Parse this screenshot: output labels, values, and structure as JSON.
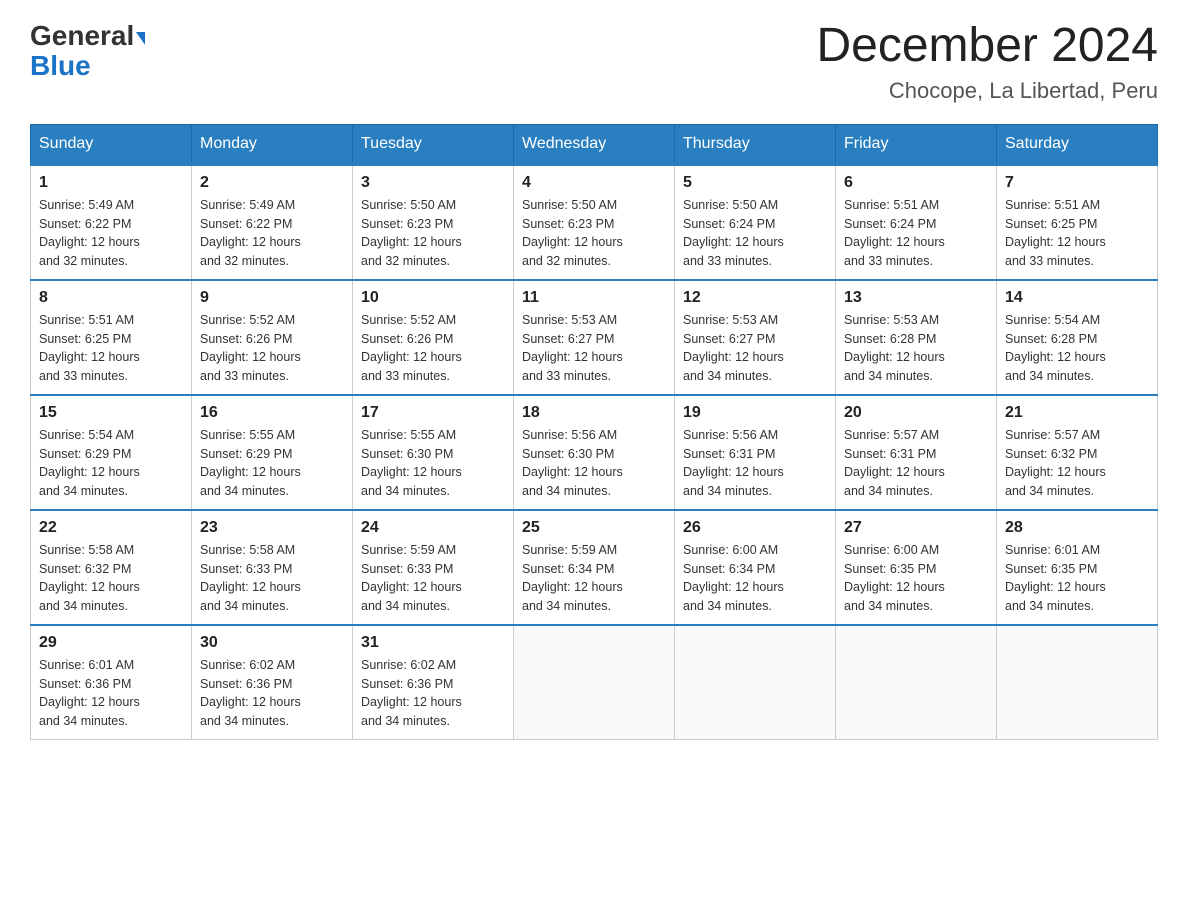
{
  "header": {
    "logo_general": "General",
    "logo_blue": "Blue",
    "month_title": "December 2024",
    "location": "Chocope, La Libertad, Peru"
  },
  "days_of_week": [
    "Sunday",
    "Monday",
    "Tuesday",
    "Wednesday",
    "Thursday",
    "Friday",
    "Saturday"
  ],
  "weeks": [
    [
      {
        "day": "1",
        "sunrise": "5:49 AM",
        "sunset": "6:22 PM",
        "daylight": "12 hours and 32 minutes."
      },
      {
        "day": "2",
        "sunrise": "5:49 AM",
        "sunset": "6:22 PM",
        "daylight": "12 hours and 32 minutes."
      },
      {
        "day": "3",
        "sunrise": "5:50 AM",
        "sunset": "6:23 PM",
        "daylight": "12 hours and 32 minutes."
      },
      {
        "day": "4",
        "sunrise": "5:50 AM",
        "sunset": "6:23 PM",
        "daylight": "12 hours and 32 minutes."
      },
      {
        "day": "5",
        "sunrise": "5:50 AM",
        "sunset": "6:24 PM",
        "daylight": "12 hours and 33 minutes."
      },
      {
        "day": "6",
        "sunrise": "5:51 AM",
        "sunset": "6:24 PM",
        "daylight": "12 hours and 33 minutes."
      },
      {
        "day": "7",
        "sunrise": "5:51 AM",
        "sunset": "6:25 PM",
        "daylight": "12 hours and 33 minutes."
      }
    ],
    [
      {
        "day": "8",
        "sunrise": "5:51 AM",
        "sunset": "6:25 PM",
        "daylight": "12 hours and 33 minutes."
      },
      {
        "day": "9",
        "sunrise": "5:52 AM",
        "sunset": "6:26 PM",
        "daylight": "12 hours and 33 minutes."
      },
      {
        "day": "10",
        "sunrise": "5:52 AM",
        "sunset": "6:26 PM",
        "daylight": "12 hours and 33 minutes."
      },
      {
        "day": "11",
        "sunrise": "5:53 AM",
        "sunset": "6:27 PM",
        "daylight": "12 hours and 33 minutes."
      },
      {
        "day": "12",
        "sunrise": "5:53 AM",
        "sunset": "6:27 PM",
        "daylight": "12 hours and 34 minutes."
      },
      {
        "day": "13",
        "sunrise": "5:53 AM",
        "sunset": "6:28 PM",
        "daylight": "12 hours and 34 minutes."
      },
      {
        "day": "14",
        "sunrise": "5:54 AM",
        "sunset": "6:28 PM",
        "daylight": "12 hours and 34 minutes."
      }
    ],
    [
      {
        "day": "15",
        "sunrise": "5:54 AM",
        "sunset": "6:29 PM",
        "daylight": "12 hours and 34 minutes."
      },
      {
        "day": "16",
        "sunrise": "5:55 AM",
        "sunset": "6:29 PM",
        "daylight": "12 hours and 34 minutes."
      },
      {
        "day": "17",
        "sunrise": "5:55 AM",
        "sunset": "6:30 PM",
        "daylight": "12 hours and 34 minutes."
      },
      {
        "day": "18",
        "sunrise": "5:56 AM",
        "sunset": "6:30 PM",
        "daylight": "12 hours and 34 minutes."
      },
      {
        "day": "19",
        "sunrise": "5:56 AM",
        "sunset": "6:31 PM",
        "daylight": "12 hours and 34 minutes."
      },
      {
        "day": "20",
        "sunrise": "5:57 AM",
        "sunset": "6:31 PM",
        "daylight": "12 hours and 34 minutes."
      },
      {
        "day": "21",
        "sunrise": "5:57 AM",
        "sunset": "6:32 PM",
        "daylight": "12 hours and 34 minutes."
      }
    ],
    [
      {
        "day": "22",
        "sunrise": "5:58 AM",
        "sunset": "6:32 PM",
        "daylight": "12 hours and 34 minutes."
      },
      {
        "day": "23",
        "sunrise": "5:58 AM",
        "sunset": "6:33 PM",
        "daylight": "12 hours and 34 minutes."
      },
      {
        "day": "24",
        "sunrise": "5:59 AM",
        "sunset": "6:33 PM",
        "daylight": "12 hours and 34 minutes."
      },
      {
        "day": "25",
        "sunrise": "5:59 AM",
        "sunset": "6:34 PM",
        "daylight": "12 hours and 34 minutes."
      },
      {
        "day": "26",
        "sunrise": "6:00 AM",
        "sunset": "6:34 PM",
        "daylight": "12 hours and 34 minutes."
      },
      {
        "day": "27",
        "sunrise": "6:00 AM",
        "sunset": "6:35 PM",
        "daylight": "12 hours and 34 minutes."
      },
      {
        "day": "28",
        "sunrise": "6:01 AM",
        "sunset": "6:35 PM",
        "daylight": "12 hours and 34 minutes."
      }
    ],
    [
      {
        "day": "29",
        "sunrise": "6:01 AM",
        "sunset": "6:36 PM",
        "daylight": "12 hours and 34 minutes."
      },
      {
        "day": "30",
        "sunrise": "6:02 AM",
        "sunset": "6:36 PM",
        "daylight": "12 hours and 34 minutes."
      },
      {
        "day": "31",
        "sunrise": "6:02 AM",
        "sunset": "6:36 PM",
        "daylight": "12 hours and 34 minutes."
      },
      null,
      null,
      null,
      null
    ]
  ],
  "labels": {
    "sunrise": "Sunrise:",
    "sunset": "Sunset:",
    "daylight": "Daylight:"
  }
}
